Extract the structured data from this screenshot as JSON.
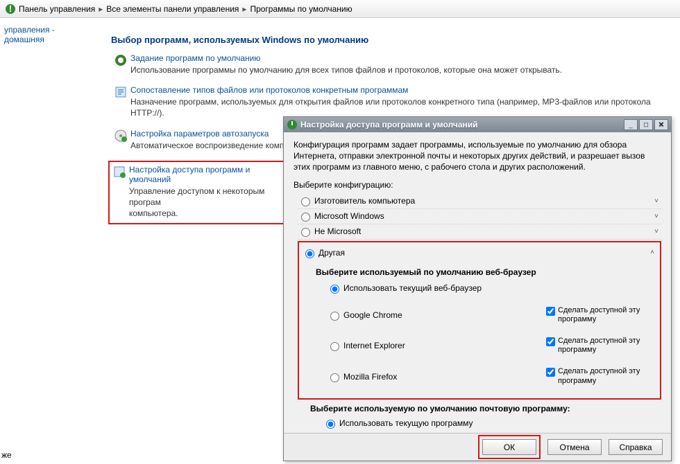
{
  "breadcrumb": {
    "parts": [
      "Панель управления",
      "Все элементы панели управления",
      "Программы по умолчанию"
    ]
  },
  "sidebar": {
    "home_link": "управления - домашняя"
  },
  "main": {
    "heading": "Выбор программ, используемых Windows по умолчанию",
    "items": [
      {
        "link": "Задание программ по умолчанию",
        "desc": "Использование программы по умолчанию для всех типов файлов и протоколов, которые она может открывать."
      },
      {
        "link": "Сопоставление типов файлов или протоколов конкретным программам",
        "desc": "Назначение программ, используемых для открытия файлов или протоколов конкретного типа (например, MP3-файлов  или протокола HTTP://)."
      },
      {
        "link": "Настройка параметров автозапуска",
        "desc": "Автоматическое воспроизведение компакт-"
      },
      {
        "link": "Настройка доступа программ и умолчаний",
        "desc": "Управление доступом к некоторым програм\nкомпьютера."
      }
    ]
  },
  "dialog": {
    "title": "Настройка доступа программ и умолчаний",
    "intro": "Конфигурация программ задает программы, используемые по умолчанию для обзора Интернета, отправки электронной почты и некоторых других действий, и разрешает вызов этих программ из главного меню, с рабочего стола и других расположений.",
    "choose_config": "Выберите конфигурацию:",
    "configs": [
      {
        "label": "Изготовитель компьютера",
        "chev": "˅"
      },
      {
        "label": "Microsoft Windows",
        "chev": "˅"
      },
      {
        "label": "Не Microsoft",
        "chev": "˅"
      }
    ],
    "config_open": {
      "label": "Другая",
      "chev": "˄"
    },
    "browser_title": "Выберите используемый по умолчанию веб-браузер",
    "browser_opts": [
      {
        "label": "Использовать текущий веб-браузер",
        "enable": null
      },
      {
        "label": "Google Chrome",
        "enable": "Сделать доступной эту программу"
      },
      {
        "label": "Internet Explorer",
        "enable": "Сделать доступной эту программу"
      },
      {
        "label": "Mozilla Firefox",
        "enable": "Сделать доступной эту программу"
      }
    ],
    "mail_title": "Выберите используемую по умолчанию почтовую программу:",
    "mail_opt": "Использовать текущую программу",
    "buttons": {
      "ok": "ОК",
      "cancel": "Отмена",
      "help": "Справка"
    }
  },
  "bottom_text": "же"
}
